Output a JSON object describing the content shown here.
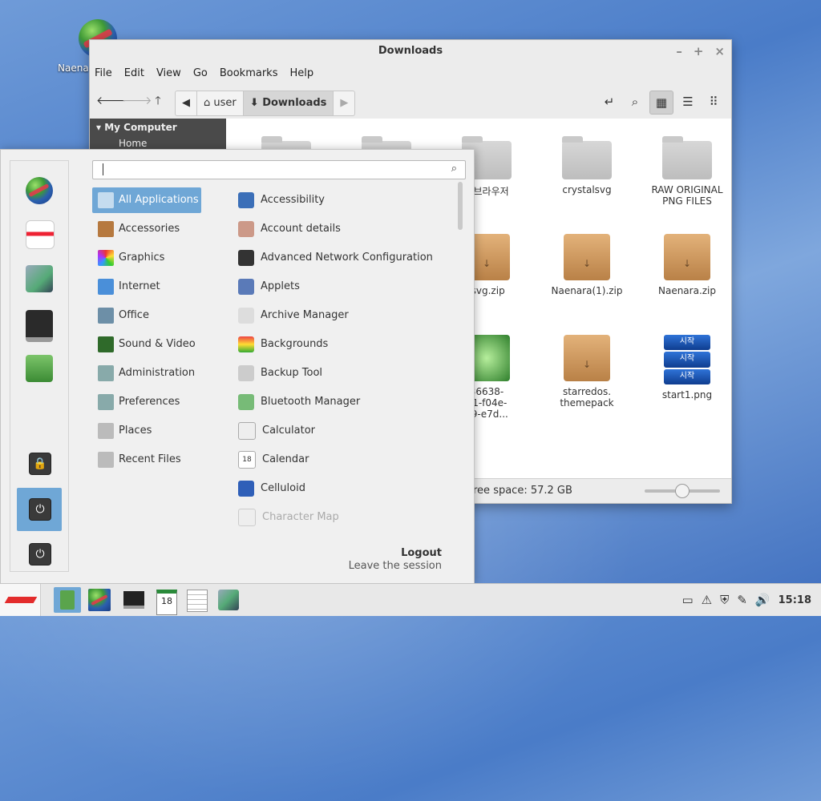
{
  "desktop": {
    "icon_label": "Naena"
  },
  "file_manager": {
    "title": "Downloads",
    "window_buttons": [
      "–",
      "+",
      "×"
    ],
    "menu": [
      "File",
      "Edit",
      "View",
      "Go",
      "Bookmarks",
      "Help"
    ],
    "path": [
      "user",
      "Downloads"
    ],
    "sidebar": {
      "section": "My Computer",
      "items": [
        "Home"
      ]
    },
    "items": [
      {
        "label": "a 브라우저",
        "kind": "folder"
      },
      {
        "label": "crystalsvg",
        "kind": "folder"
      },
      {
        "label": "RAW ORIGINAL\nPNG FILES",
        "kind": "folder"
      },
      {
        "label": "lsvg.zip",
        "kind": "zip"
      },
      {
        "label": "Naenara(1).zip",
        "kind": "zip"
      },
      {
        "label": "Naenara.zip",
        "kind": "zip"
      },
      {
        "label": "36638-\nb1-f04e-\n89-e7d...",
        "kind": "image"
      },
      {
        "label": "starredos.\nthemepack",
        "kind": "zip"
      },
      {
        "label": "start1.png",
        "kind": "start"
      }
    ],
    "start_img_text": "시작",
    "status": "ree space: 57.2 GB"
  },
  "app_menu": {
    "search_placeholder": "",
    "categories": [
      "All Applications",
      "Accessories",
      "Graphics",
      "Internet",
      "Office",
      "Sound & Video",
      "Administration",
      "Preferences",
      "Places",
      "Recent Files"
    ],
    "selected_category": "All Applications",
    "apps": [
      "Accessibility",
      "Account details",
      "Advanced Network Configuration",
      "Applets",
      "Archive Manager",
      "Backgrounds",
      "Backup Tool",
      "Bluetooth Manager",
      "Calculator",
      "Calendar",
      "Celluloid",
      "Character Map"
    ],
    "logout_title": "Logout",
    "logout_subtitle": "Leave the session"
  },
  "taskbar": {
    "clock": "15:18",
    "calendar_day": "18"
  },
  "colors": {
    "selection": "#6fa7d6",
    "sidebar": "#4a4a4a"
  }
}
